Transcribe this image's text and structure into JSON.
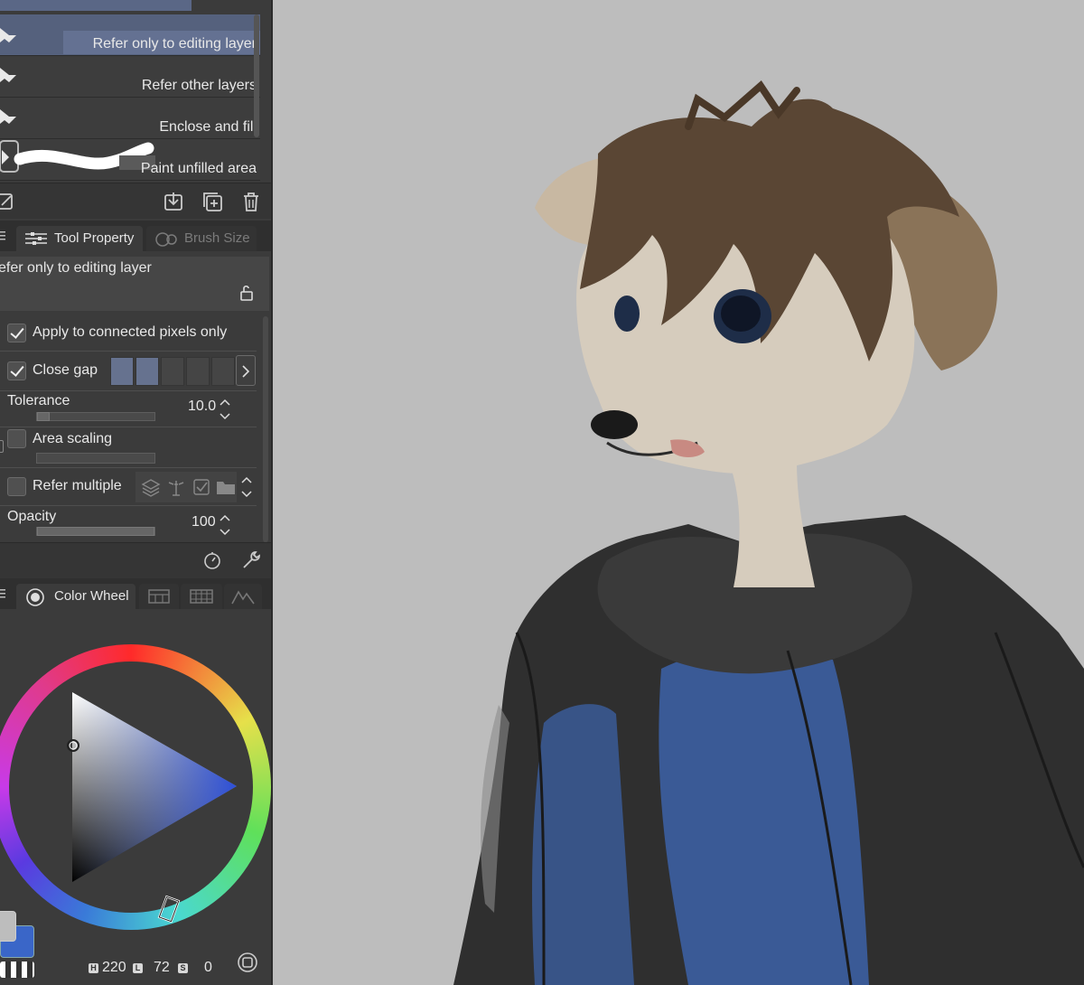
{
  "subtool": {
    "items": [
      {
        "label": "Refer only to editing layer",
        "selected": true
      },
      {
        "label": "Refer other layers",
        "selected": false
      },
      {
        "label": "Enclose and fill",
        "selected": false
      },
      {
        "label": "Paint unfilled area",
        "selected": false
      }
    ],
    "toolbar_icons": [
      "edit-icon",
      "download-icon",
      "duplicate-icon",
      "trash-icon"
    ]
  },
  "property_tabs": {
    "tool_property": "Tool Property",
    "brush_size": "Brush Size"
  },
  "tool_property": {
    "subtool_name": "efer only to editing layer",
    "apply_connected": {
      "label": "Apply to connected pixels only",
      "checked": true
    },
    "close_gap": {
      "label": "Close gap",
      "checked": true,
      "level": 2,
      "levels": 5
    },
    "tolerance": {
      "label": "Tolerance",
      "value": "10.0"
    },
    "area_scaling": {
      "label": "Area scaling",
      "checked": false
    },
    "refer_multiple": {
      "label": "Refer multiple",
      "checked": false
    },
    "opacity": {
      "label": "Opacity",
      "value": "100"
    }
  },
  "color_tabs": {
    "color_wheel": "Color Wheel"
  },
  "color": {
    "main_color": "#3a66c8",
    "sub_color": "#bdbdbd",
    "h_tag": "H",
    "h": "220",
    "l_tag": "L",
    "l": "72",
    "s_tag": "S",
    "s": "0"
  },
  "colors": {
    "selection": "#55617d",
    "panel_bg": "#3b3b3b",
    "canvas_bg": "#bdbdbd",
    "jacket": "#2e2e2e",
    "shirt": "#3a5a96",
    "hair": "#5a4634",
    "fur": "#d6ccbd"
  }
}
